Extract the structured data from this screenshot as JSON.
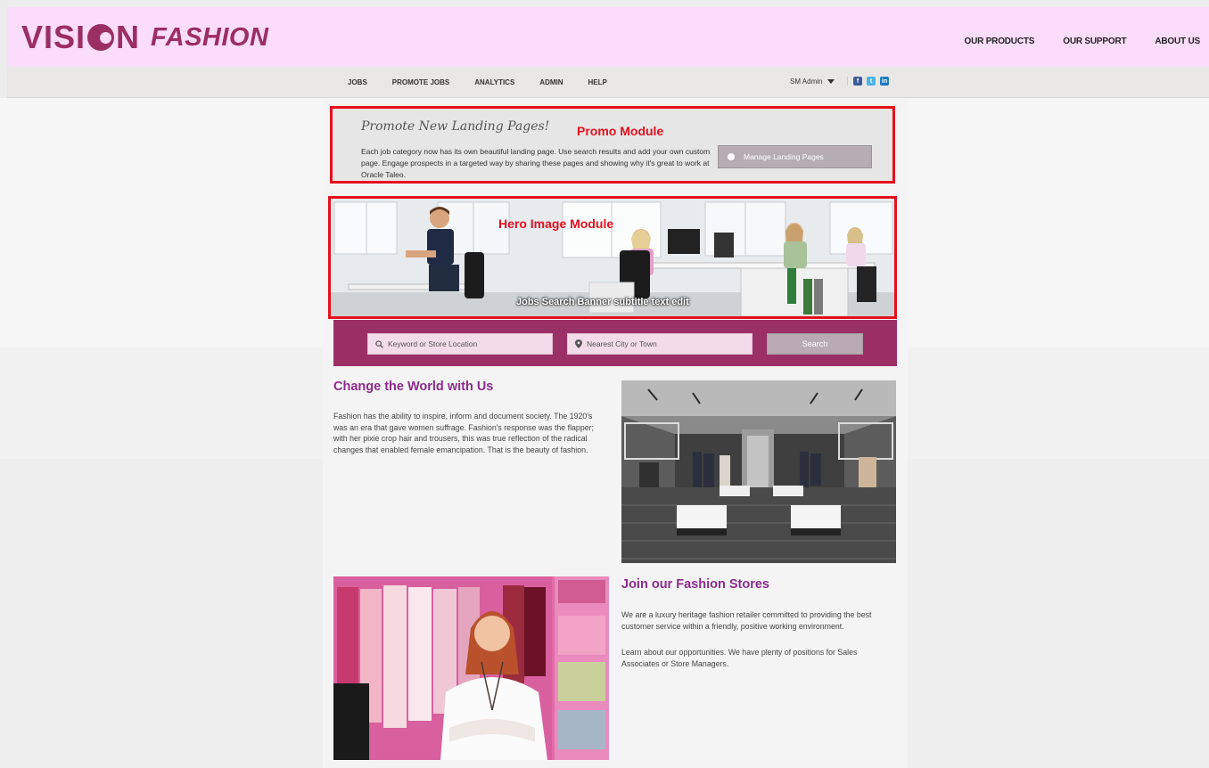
{
  "header": {
    "logo_vision_left": "VISI",
    "logo_vision_right": "N",
    "logo_fashion": "FASHION",
    "nav": [
      "OUR PRODUCTS",
      "OUR SUPPORT",
      "ABOUT US"
    ]
  },
  "subnav": {
    "links": [
      "JOBS",
      "PROMOTE JOBS",
      "ANALYTICS",
      "ADMIN",
      "HELP"
    ],
    "account": "SM Admin",
    "socials": [
      "facebook-icon",
      "twitter-icon",
      "linkedin-icon"
    ]
  },
  "promo": {
    "script_heading": "Promote New Landing Pages!",
    "label": "Promo Module",
    "text": "Each job category now has its own beautiful landing page. Use search results and add your own custom page. Engage prospects in a targeted way by sharing these pages and showing why it's great to work at Oracle Taleo.",
    "button": "Manage Landing Pages"
  },
  "hero": {
    "label": "Hero Image Module",
    "subtitle": "Jobs Search Banner subtitle text edit"
  },
  "search": {
    "keyword_placeholder": "Keyword or Store Location",
    "location_placeholder": "Nearest City or Town",
    "button": "Search"
  },
  "section1": {
    "title": "Change the World with Us",
    "text": "Fashion has the ability to inspire, inform and document society. The 1920's was an era that gave women suffrage. Fashion's response was the flapper; with her pixie crop hair and trousers, this was true reflection of the radical changes that enabled female emancipation. That is the beauty of fashion."
  },
  "section2": {
    "title": "Join our Fashion Stores",
    "text1": "We are a luxury heritage fashion retailer committed to providing the best customer service within a friendly, positive working environment.",
    "text2": "Learn about our opportunities. We have plenty of positions for Sales Associates or Store Managers."
  },
  "colors": {
    "brand": "#9b2e63",
    "header_bg": "#fbdcfb",
    "annotation_red": "#e5101e",
    "heading_purple": "#8c2b8e",
    "search_bar": "#9b3067"
  }
}
